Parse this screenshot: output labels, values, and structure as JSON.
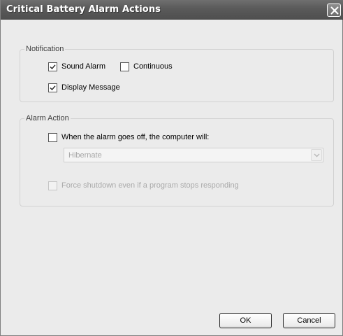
{
  "window": {
    "title": "Critical Battery Alarm Actions"
  },
  "notification": {
    "group_label": "Notification",
    "sound_alarm": {
      "label": "Sound Alarm",
      "checked": true
    },
    "continuous": {
      "label": "Continuous",
      "checked": false
    },
    "display_message": {
      "label": "Display Message",
      "checked": true
    }
  },
  "alarm_action": {
    "group_label": "Alarm Action",
    "when_alarm": {
      "label": "When the alarm goes off, the computer will:",
      "checked": false
    },
    "action_select": {
      "value": "Hibernate",
      "enabled": false
    },
    "force_shutdown": {
      "label": "Force shutdown even if a program stops responding",
      "checked": false,
      "enabled": false
    }
  },
  "buttons": {
    "ok_label": "OK",
    "cancel_label": "Cancel"
  },
  "icons": {
    "close": "close-icon",
    "check": "checkmark-icon",
    "dropdown": "chevron-down-icon"
  }
}
